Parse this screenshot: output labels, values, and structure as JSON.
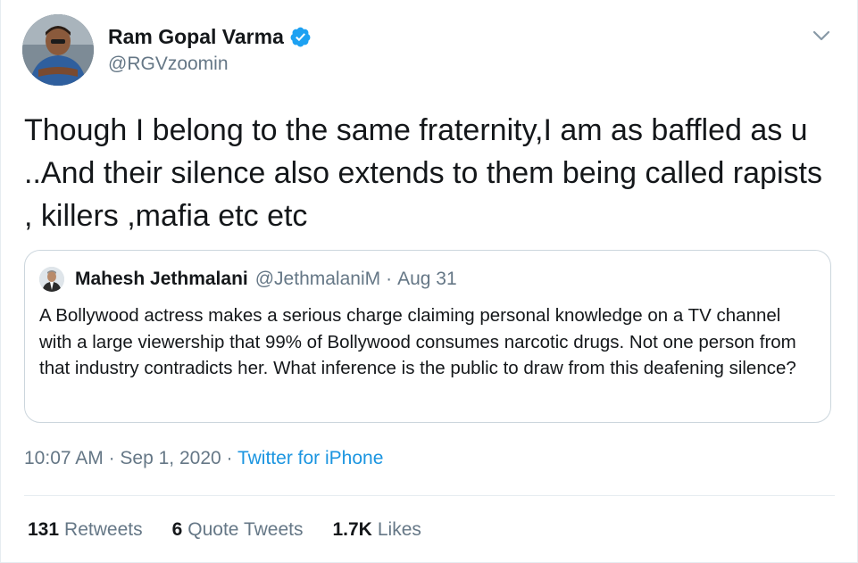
{
  "author": {
    "name": "Ram Gopal Varma",
    "handle": "@RGVzoomin",
    "verified": true
  },
  "tweet": {
    "text": "Though I belong to the same fraternity,I am as baffled as u ..And their silence also extends to them being called rapists , killers ,mafia etc etc"
  },
  "quote": {
    "name": "Mahesh Jethmalani",
    "handle": "@JethmalaniM",
    "separator": "·",
    "date": "Aug 31",
    "text": "A Bollywood actress makes a serious charge claiming personal knowledge on a TV channel with a large viewership that 99% of Bollywood consumes narcotic drugs. Not one person from that industry contradicts her. What inference is the public to draw from this deafening silence?"
  },
  "meta": {
    "time": "10:07 AM",
    "separator1": " · ",
    "date": "Sep 1, 2020",
    "separator2": " · ",
    "source": "Twitter for iPhone"
  },
  "stats": {
    "retweets_count": "131",
    "retweets_label": "Retweets",
    "quotes_count": "6",
    "quotes_label": "Quote Tweets",
    "likes_count": "1.7K",
    "likes_label": "Likes"
  },
  "icons": {
    "verified": "verified-badge-icon",
    "caret": "chevron-down-icon"
  },
  "colors": {
    "text": "#14171a",
    "secondary": "#657786",
    "link": "#1b95e0",
    "verified": "#1da1f2",
    "border": "#ccd6dd"
  }
}
